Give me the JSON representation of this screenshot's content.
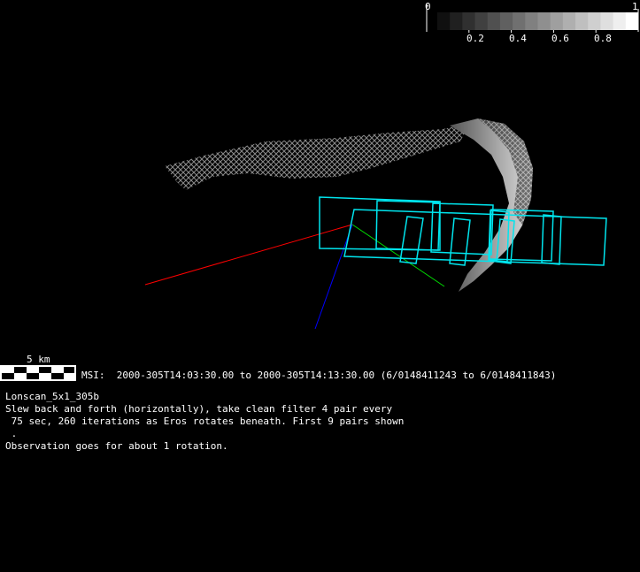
{
  "colorbar": {
    "min_label": "0",
    "max_label": "1",
    "tick_labels": [
      "0.2",
      "0.4",
      "0.6",
      "0.8"
    ],
    "steps": 16
  },
  "scale_bar": {
    "label": "5 km"
  },
  "instrument_line": "MSI:  2000-305T14:03:30.00 to 2000-305T14:13:30.00 (6/0148411243 to 6/0148411843)",
  "description": {
    "title": "Lonscan_5x1_305b",
    "line1": "Slew back and forth (horizontally), take clean filter 4 pair every",
    "line2": " 75 sec, 260 iterations as Eros rotates beneath. First 9 pairs shown",
    "line3": " .",
    "line4": "Observation goes for about 1 rotation."
  },
  "colors": {
    "footprint": "#00e5ee",
    "x_axis": "#ff0000",
    "y_axis": "#00dd00",
    "z_axis": "#0000ff",
    "asteroid": "#9a9a9a"
  }
}
